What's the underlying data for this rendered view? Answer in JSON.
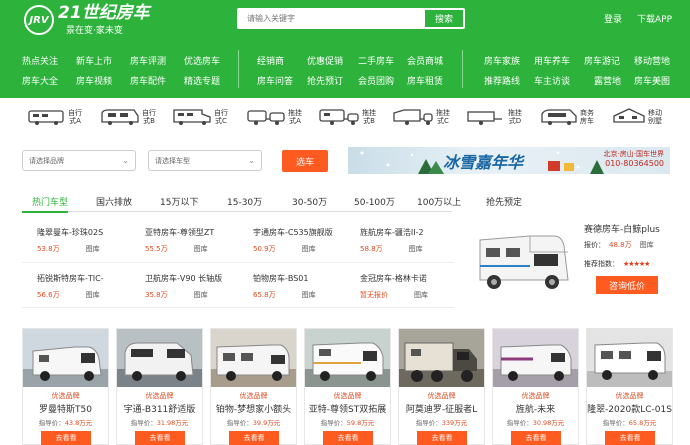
{
  "header": {
    "logo_mark": "JRV",
    "logo_name": "21世纪房车",
    "logo_slogan": "景在变·家未变",
    "search_placeholder": "请输入关键字",
    "search_button": "搜索",
    "login": "登录",
    "download": "下载APP",
    "brand_color": "#2db33c"
  },
  "nav": {
    "row1": [
      "热点关注",
      "新车上市",
      "房车评测",
      "优选房车",
      "经销商",
      "优惠促销",
      "二手房车",
      "会员商城",
      "房车家族",
      "用车养车",
      "房车游记",
      "移动营地"
    ],
    "row2": [
      "房车大全",
      "房车视频",
      "房车配件",
      "精选专题",
      "房车问答",
      "抢先预订",
      "会员团购",
      "房车租赁",
      "推荐路线",
      "车主访谈",
      "露营地",
      "房车美图"
    ]
  },
  "types": [
    {
      "label": "自行式A",
      "icon": "motorhome-a-icon"
    },
    {
      "label": "自行式B",
      "icon": "motorhome-b-icon"
    },
    {
      "label": "自行式C",
      "icon": "motorhome-c-icon"
    },
    {
      "label": "拖挂式A",
      "icon": "trailer-a-icon"
    },
    {
      "label": "拖挂式B",
      "icon": "trailer-b-icon"
    },
    {
      "label": "拖挂式C",
      "icon": "trailer-c-icon"
    },
    {
      "label": "拖挂式D",
      "icon": "trailer-d-icon"
    },
    {
      "label": "商务房车",
      "icon": "business-van-icon"
    },
    {
      "label": "移动别墅",
      "icon": "mobile-villa-icon"
    }
  ],
  "filters": {
    "brand_select": "请选择品牌",
    "type_select": "请选择车型",
    "pick_button": "选车",
    "banner_title": "冰雪嘉年华",
    "banner_sub1": "北京·房山·国车世界",
    "banner_sub2": "010-80364500"
  },
  "tabs": [
    "热门车型",
    "国六排放",
    "15万以下",
    "15-30万",
    "30-50万",
    "50-100万",
    "100万以上",
    "抢先预定"
  ],
  "models": [
    {
      "name": "隆翠曼车-珍珠02S",
      "price": "53.8万",
      "link": "图库"
    },
    {
      "name": "亚特房车-尊领型ZT",
      "price": "55.5万",
      "link": "图库"
    },
    {
      "name": "宇通房车-C535旗舰版",
      "price": "50.9万",
      "link": "图库"
    },
    {
      "name": "旌航房车-疆浩II-2",
      "price": "58.8万",
      "link": "图库"
    },
    {
      "name": "拓锐斯特房车-TIC-",
      "price": "56.6万",
      "link": "图库"
    },
    {
      "name": "卫航房车-V90 长轴版",
      "price": "35.8万",
      "link": "图库"
    },
    {
      "name": "铂物房车-BS01",
      "price": "65.8万",
      "link": "图库"
    },
    {
      "name": "金冠房车-格林卡诺",
      "price": "暂无报价",
      "link": "图库"
    }
  ],
  "feature": {
    "name": "赛德房车-白鲸plus",
    "price_label": "报价：",
    "price": "48.8万",
    "gallery": "图库",
    "score_label": "推荐指数：",
    "stars": "★★★★★",
    "button": "咨询低价"
  },
  "cards": [
    {
      "badge": "优选品牌",
      "name": "罗曼特斯T50",
      "price_label": "指导价：",
      "price": "43.8万元",
      "button": "去看看"
    },
    {
      "badge": "优选品牌",
      "name": "宇通-B311舒适版",
      "price_label": "指导价：",
      "price": "31.98万元",
      "button": "去看看"
    },
    {
      "badge": "优选品牌",
      "name": "铂物-梦想家小额头",
      "price_label": "指导价：",
      "price": "39.9万元",
      "button": "去看看"
    },
    {
      "badge": "优选品牌",
      "name": "亚特-尊领ST双拓展",
      "price_label": "指导价：",
      "price": "59.8万元",
      "button": "去看看"
    },
    {
      "badge": "优选品牌",
      "name": "阿莫迪罗-征服者L",
      "price_label": "指导价：",
      "price": "339万元",
      "button": "去看看"
    },
    {
      "badge": "优选品牌",
      "name": "旌航-未来",
      "price_label": "指导价：",
      "price": "30.98万元",
      "button": "去看看"
    },
    {
      "badge": "优选品牌",
      "name": "隆翠-2020款LC-01S",
      "price_label": "指导价：",
      "price": "65.8万元",
      "button": "去看看"
    }
  ]
}
